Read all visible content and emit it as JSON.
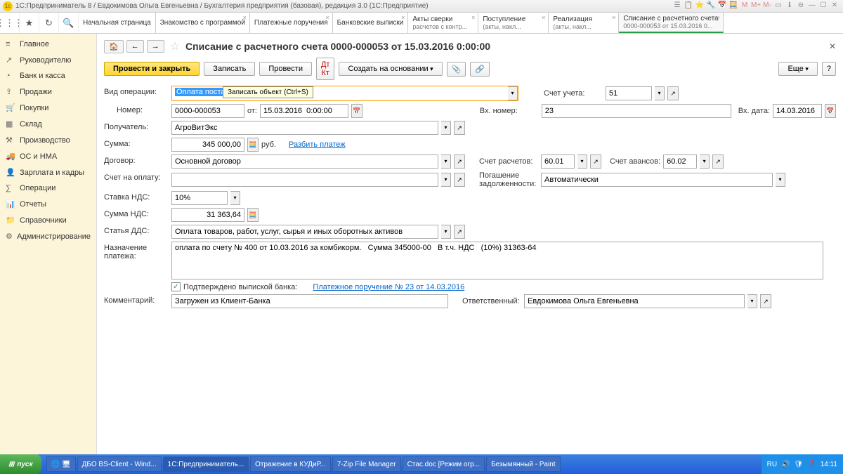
{
  "titlebar": {
    "text": "1С:Предприниматель 8 / Евдокимова Ольга Евгеньевна / Бухгалтерия предприятия (базовая), редакция 3.0  (1С:Предприятие)"
  },
  "tabs": [
    {
      "label": "Начальная страница"
    },
    {
      "label": "Знакомство с программой"
    },
    {
      "label": "Платежные поручения"
    },
    {
      "label": "Банковские выписки"
    },
    {
      "label": "Акты сверки",
      "sub": "расчетов с контр..."
    },
    {
      "label": "Поступление",
      "sub": "(акты, накл..."
    },
    {
      "label": "Реализация",
      "sub": "(акты, накл..."
    },
    {
      "label": "Списание с расчетного счета",
      "sub": "0000-000053 от 15.03.2016 0..."
    }
  ],
  "sidebar": [
    {
      "icon": "≡",
      "label": "Главное"
    },
    {
      "icon": "↗",
      "label": "Руководителю"
    },
    {
      "icon": "◔",
      "label": "Банк и касса"
    },
    {
      "icon": "⇪",
      "label": "Продажи"
    },
    {
      "icon": "🛒",
      "label": "Покупки"
    },
    {
      "icon": "▦",
      "label": "Склад"
    },
    {
      "icon": "⚒",
      "label": "Производство"
    },
    {
      "icon": "🚚",
      "label": "ОС и НМА"
    },
    {
      "icon": "👤",
      "label": "Зарплата и кадры"
    },
    {
      "icon": "∑",
      "label": "Операции"
    },
    {
      "icon": "📊",
      "label": "Отчеты"
    },
    {
      "icon": "📁",
      "label": "Справочники"
    },
    {
      "icon": "⚙",
      "label": "Администрирование"
    }
  ],
  "doc": {
    "title": "Списание с расчетного счета 0000-000053 от 15.03.2016 0:00:00",
    "primary_btn": "Провести и закрыть",
    "save_btn": "Записать",
    "post_btn": "Провести",
    "create_based": "Создать на основании",
    "more_btn": "Еще",
    "tooltip": "Записать объект (Ctrl+S)"
  },
  "fields": {
    "op_type_label": "Вид операции:",
    "op_type_value": "Оплата постав",
    "account_label": "Счет учета:",
    "account_value": "51",
    "number_label": "Номер:",
    "number_value": "0000-000053",
    "from_label": "от:",
    "date_value": "15.03.2016  0:00:00",
    "in_number_label": "Вх. номер:",
    "in_number_value": "23",
    "in_date_label": "Вх. дата:",
    "in_date_value": "14.03.2016",
    "recipient_label": "Получатель:",
    "recipient_value": "АгроВитЭкс",
    "sum_label": "Сумма:",
    "sum_value": "345 000,00",
    "currency": "руб.",
    "split_link": "Разбить платеж",
    "contract_label": "Договор:",
    "contract_value": "Основной договор",
    "settle_acc_label": "Счет расчетов:",
    "settle_acc_value": "60.01",
    "advance_acc_label": "Счет авансов:",
    "advance_acc_value": "60.02",
    "invoice_label": "Счет на оплату:",
    "debt_label": "Погашение задолженности:",
    "debt_value": "Автоматически",
    "vat_rate_label": "Ставка НДС:",
    "vat_rate_value": "10%",
    "vat_sum_label": "Сумма НДС:",
    "vat_sum_value": "31 363,64",
    "dds_label": "Статья ДДС:",
    "dds_value": "Оплата товаров, работ, услуг, сырья и иных оборотных активов",
    "purpose_label": "Назначение платежа:",
    "purpose_value": "оплата по счету № 400 от 10.03.2016 за комбикорм.   Сумма 345000-00   В т.ч. НДС   (10%) 31363-64",
    "confirmed_label": "Подтверждено выпиской банка:",
    "payment_link": "Платежное поручение № 23 от 14.03.2016",
    "comment_label": "Комментарий:",
    "comment_value": "Загружен из Клиент-Банка",
    "responsible_label": "Ответственный:",
    "responsible_value": "Евдокимова Ольга Евгеньевна"
  },
  "taskbar": {
    "start": "пуск",
    "tasks": [
      {
        "label": "ДБО BS-Client - Wind..."
      },
      {
        "label": "1С:Предприниматель..."
      },
      {
        "label": "Отражение в КУДиР..."
      },
      {
        "label": "7-Zip File Manager"
      },
      {
        "label": "Стас.doc [Режим огр..."
      },
      {
        "label": "Безымянный - Paint"
      }
    ],
    "lang": "RU",
    "time": "14:11"
  }
}
